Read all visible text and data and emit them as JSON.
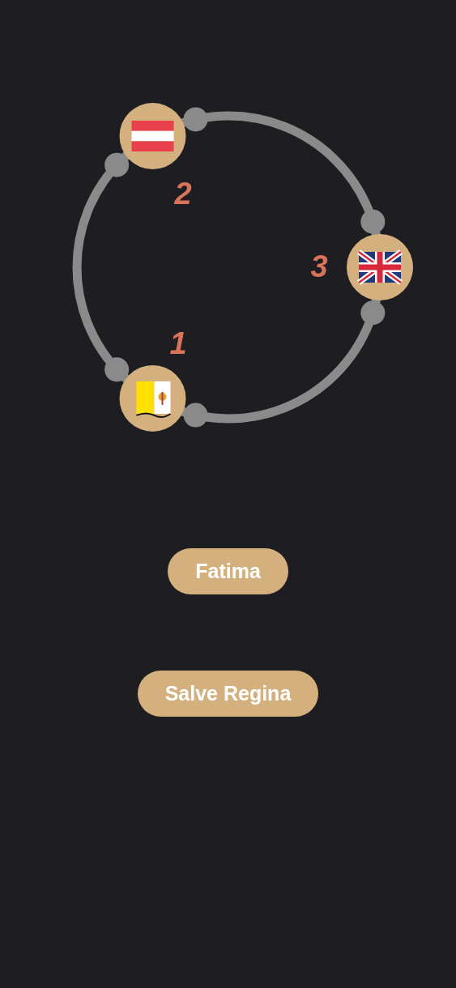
{
  "ring": {
    "nodes": [
      {
        "label": "1"
      },
      {
        "label": "2"
      },
      {
        "label": "3"
      }
    ]
  },
  "buttons": [
    {
      "label": "Fatima"
    },
    {
      "label": "Salve Regina"
    }
  ]
}
